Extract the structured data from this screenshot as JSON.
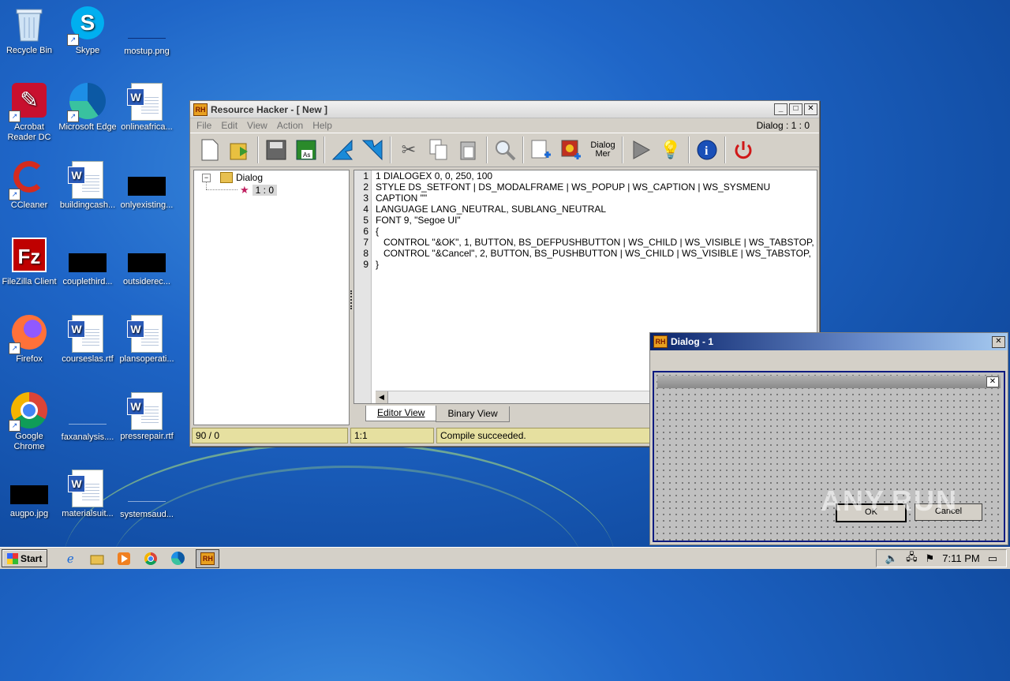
{
  "desktop": {
    "icons": [
      {
        "label": "Recycle Bin"
      },
      {
        "label": "Skype"
      },
      {
        "label": "mostup.png"
      },
      {
        "label": "Acrobat Reader DC"
      },
      {
        "label": "Microsoft Edge"
      },
      {
        "label": "onlineafrica..."
      },
      {
        "label": "CCleaner"
      },
      {
        "label": "buildingcash..."
      },
      {
        "label": "onlyexisting..."
      },
      {
        "label": "FileZilla Client"
      },
      {
        "label": "couplethird..."
      },
      {
        "label": "outsiderec..."
      },
      {
        "label": "Firefox"
      },
      {
        "label": "courseslas.rtf"
      },
      {
        "label": "plansoperati..."
      },
      {
        "label": "Google Chrome"
      },
      {
        "label": "faxanalysis...."
      },
      {
        "label": "pressrepair.rtf"
      },
      {
        "label": "augpo.jpg"
      },
      {
        "label": "materialsuit..."
      },
      {
        "label": "systemsaud..."
      }
    ]
  },
  "rh": {
    "logo": "RH",
    "title": "Resource Hacker - [ New ]",
    "menu": [
      "File",
      "Edit",
      "View",
      "Action",
      "Help"
    ],
    "resource_indicator": "Dialog : 1 : 0",
    "tree_root": "Dialog",
    "tree_child": "1 : 0",
    "line_numbers": [
      "1",
      "2",
      "3",
      "4",
      "5",
      "6",
      "7",
      "8",
      "9"
    ],
    "code": [
      "1 DIALOGEX 0, 0, 250, 100",
      "STYLE DS_SETFONT | DS_MODALFRAME | WS_POPUP | WS_CAPTION | WS_SYSMENU",
      "CAPTION \"\"",
      "LANGUAGE LANG_NEUTRAL, SUBLANG_NEUTRAL",
      "FONT 9, \"Segoe UI\"",
      "{",
      "   CONTROL \"&OK\", 1, BUTTON, BS_DEFPUSHBUTTON | WS_CHILD | WS_VISIBLE | WS_TABSTOP,",
      "   CONTROL \"&Cancel\", 2, BUTTON, BS_PUSHBUTTON | WS_CHILD | WS_VISIBLE | WS_TABSTOP,",
      "}"
    ],
    "tabs": {
      "editor": "Editor View",
      "binary": "Binary View"
    },
    "status": {
      "position": "90 / 0",
      "cursor": "1:1",
      "message": "Compile succeeded."
    },
    "toolbar_dialog_label": "Dialog Mer"
  },
  "dialog_preview": {
    "logo": "RH",
    "title": "Dialog - 1",
    "ok": "OK",
    "cancel": "Cancel"
  },
  "watermark": "ANY.RUN",
  "taskbar": {
    "start": "Start",
    "time": "7:11 PM"
  }
}
